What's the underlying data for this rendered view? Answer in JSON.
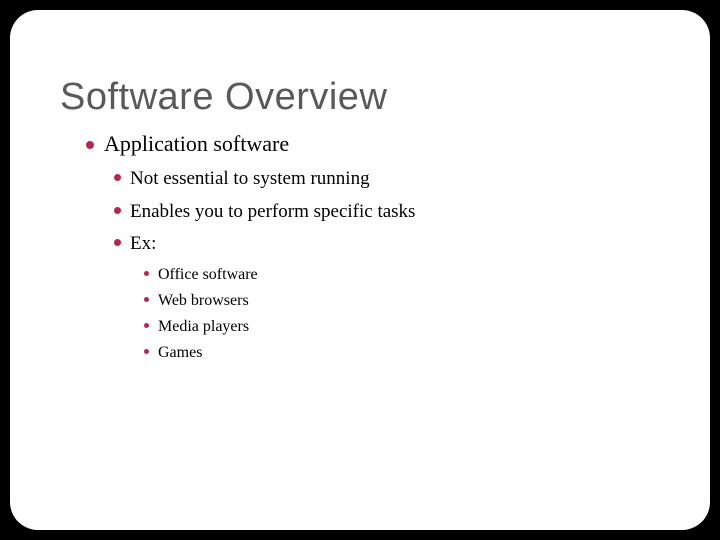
{
  "slide": {
    "title": "Software Overview",
    "level1": {
      "item0": "Application software"
    },
    "level2": {
      "item0": "Not essential to system running",
      "item1": "Enables you to perform specific tasks",
      "item2": "Ex:"
    },
    "level3": {
      "item0": "Office software",
      "item1": "Web browsers",
      "item2": "Media players",
      "item3": "Games"
    }
  },
  "colors": {
    "bullet": "#b3294b",
    "title": "#595959"
  }
}
